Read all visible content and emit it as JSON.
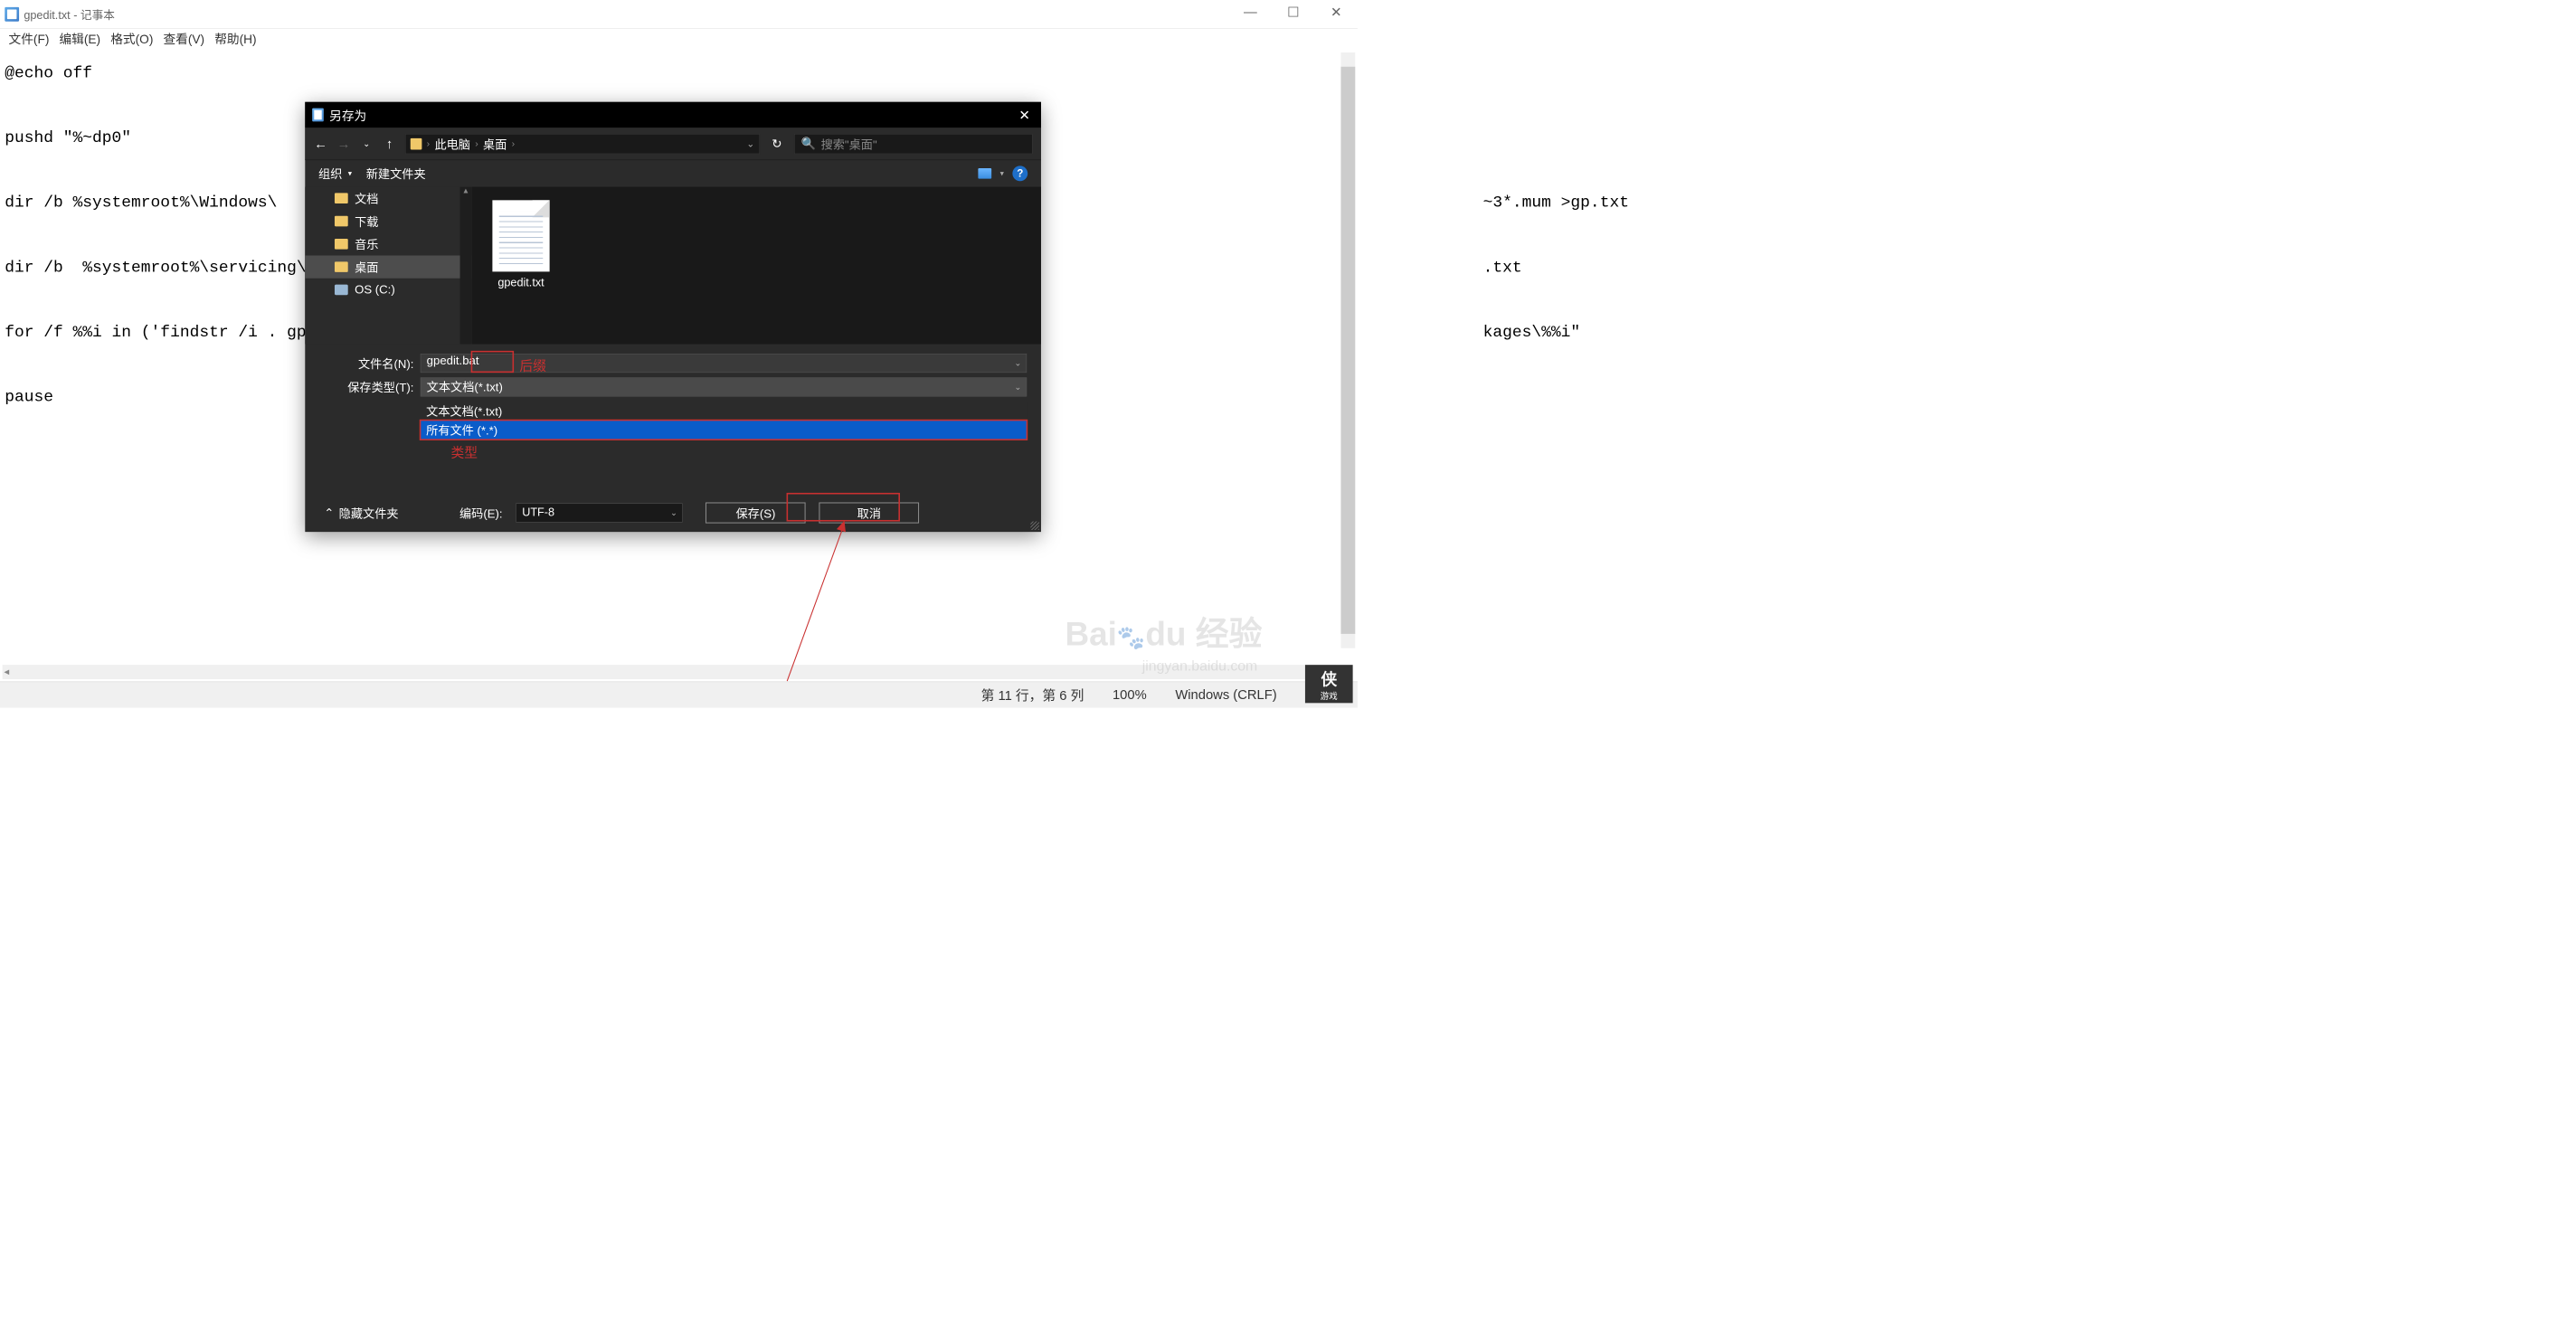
{
  "notepad": {
    "title_file": "gpedit.txt",
    "title_app": "记事本",
    "menu": {
      "file": "文件(F)",
      "edit": "编辑(E)",
      "format": "格式(O)",
      "view": "查看(V)",
      "help": "帮助(H)"
    },
    "content": "@echo off\n\npushd \"%~dp0\"\n\ndir /b %systemroot%\\Windows\\                                                                                                                            ~3*.mum >gp.txt\n\ndir /b  %systemroot%\\servicing\\                                                                                                                         .txt\n\nfor /f %%i in ('findstr /i . gp.txt 2                                                                                                                   kages\\%%i\"\n\npause",
    "status": {
      "position": "第 11 行，第 6 列",
      "zoom": "100%",
      "line_ending": "Windows (CRLF)",
      "encoding": "UTF-8"
    }
  },
  "dialog": {
    "title": "另存为",
    "breadcrumb": {
      "pc": "此电脑",
      "location": "桌面"
    },
    "search_placeholder": "搜索\"桌面\"",
    "toolbar": {
      "organize": "组织",
      "new_folder": "新建文件夹",
      "help": "?"
    },
    "sidebar": {
      "items": [
        {
          "label": "文档",
          "type": "folder"
        },
        {
          "label": "下载",
          "type": "folder"
        },
        {
          "label": "音乐",
          "type": "folder"
        },
        {
          "label": "桌面",
          "type": "folder",
          "selected": true
        },
        {
          "label": "OS (C:)",
          "type": "disk"
        }
      ]
    },
    "files": [
      {
        "name": "gpedit.txt"
      }
    ],
    "filename_label": "文件名(N):",
    "filename_value": "gpedit.bat",
    "filetype_label": "保存类型(T):",
    "filetype_value": "文本文档(*.txt)",
    "filetype_options": [
      {
        "label": "文本文档(*.txt)"
      },
      {
        "label": "所有文件 (*.*)",
        "highlighted": true
      }
    ],
    "hide_folders": "隐藏文件夹",
    "encoding_label": "编码(E):",
    "encoding_value": "UTF-8",
    "save_button": "保存(S)",
    "cancel_button": "取消",
    "annotations": {
      "suffix": "后缀",
      "type": "类型"
    }
  },
  "watermark": {
    "brand": "Bai",
    "brand2": "du",
    "brand3": "经验",
    "url": "jingyan.baidu.com",
    "logo_text_big": "侠",
    "logo_text_small": "游戏"
  }
}
